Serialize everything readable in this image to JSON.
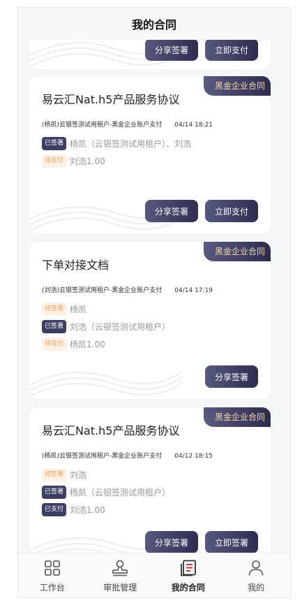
{
  "header": {
    "title": "我的合同"
  },
  "top_partial": {
    "buttons": [
      "分享签署",
      "立即支付"
    ]
  },
  "cards": [
    {
      "tag": "黑金企业合同",
      "title": "易云汇Nat.h5产品服务协议",
      "meta": "(杨凯)云银签测试用租户-黑金企业账户支付",
      "time": "04/14 18:21",
      "rows": [
        {
          "badge": "已签署",
          "style": "dark",
          "who": "杨凯（云银签测试用租户）、刘浩"
        },
        {
          "badge": "待支付",
          "style": "light",
          "who": "刘浩1.00"
        }
      ],
      "buttons": [
        "分享签署",
        "立即支付"
      ]
    },
    {
      "tag": "黑金企业合同",
      "title": "下单对接文档",
      "meta": "(刘浩)云银签测试用租户-黑金企业账户支付",
      "time": "04/14 17:19",
      "rows": [
        {
          "badge": "待签署",
          "style": "light",
          "who": "杨凯"
        },
        {
          "badge": "已签署",
          "style": "dark",
          "who": "刘浩（云银签测试用租户）"
        },
        {
          "badge": "待支付",
          "style": "light",
          "who": "杨凯1.00"
        }
      ],
      "buttons": [
        "分享签署"
      ]
    },
    {
      "tag": "黑金企业合同",
      "title": "易云汇Nat.h5产品服务协议",
      "meta": "(杨凯)云银签测试用租户-黑金企业账户支付",
      "time": "04/12 18:15",
      "rows": [
        {
          "badge": "待签署",
          "style": "light",
          "who": "刘浩"
        },
        {
          "badge": "已签署",
          "style": "dark",
          "who": "杨凯（云银签测试用租户）"
        },
        {
          "badge": "已支付",
          "style": "dark",
          "who": "刘浩1.00"
        }
      ],
      "buttons": [
        "分享签署",
        "立即签署"
      ]
    }
  ],
  "tabbar": [
    {
      "label": "工作台",
      "icon": "grid-icon",
      "active": false
    },
    {
      "label": "审批管理",
      "icon": "stamp-icon",
      "active": false
    },
    {
      "label": "我的合同",
      "icon": "contract-icon",
      "active": true
    },
    {
      "label": "我的",
      "icon": "user-icon",
      "active": false
    }
  ],
  "colors": {
    "accent_dark": "#2d2d52",
    "tag_text": "#f6d9a8",
    "pending_bg": "#fff1e6",
    "pending_text": "#f5a25a"
  }
}
